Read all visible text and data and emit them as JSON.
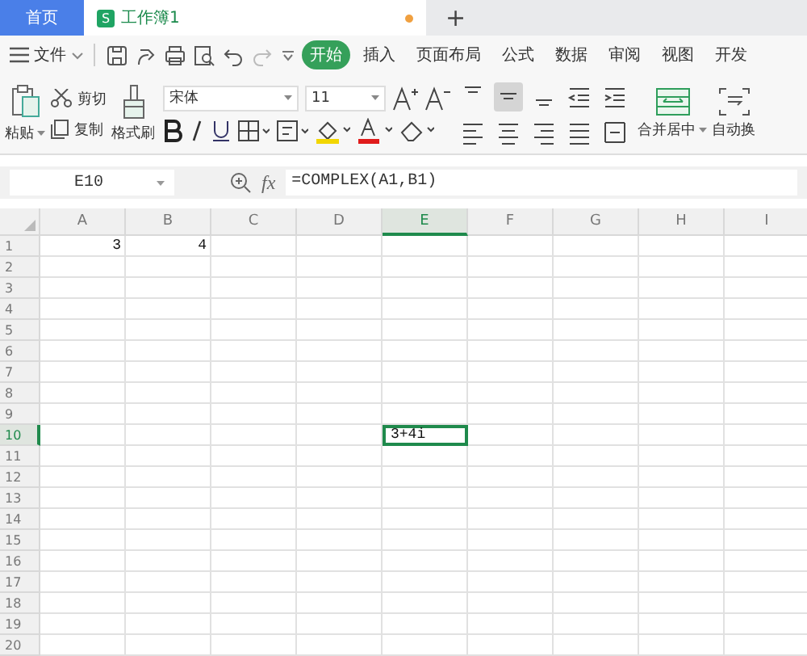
{
  "tabs": [
    {
      "kind": "home",
      "label": "首页",
      "selected": false
    },
    {
      "kind": "doc",
      "label": "工作簿1",
      "icon_letter": "S",
      "unsaved": true,
      "selected": true
    }
  ],
  "new_tab": "+",
  "menu": {
    "file": "文件",
    "items": [
      {
        "label": "开始",
        "selected": true
      },
      {
        "label": "插入",
        "selected": false
      },
      {
        "label": "页面布局",
        "selected": false
      },
      {
        "label": "公式",
        "selected": false
      },
      {
        "label": "数据",
        "selected": false
      },
      {
        "label": "审阅",
        "selected": false
      },
      {
        "label": "视图",
        "selected": false
      },
      {
        "label": "开发",
        "selected": false
      }
    ]
  },
  "clipboard": {
    "paste": "粘贴",
    "cut": "剪切",
    "copy": "复制",
    "format_painter": "格式刷"
  },
  "font": {
    "name": "宋体",
    "size": "11"
  },
  "merge": "合并居中",
  "wrap": "自动换",
  "name_box": "E10",
  "fx": "fx",
  "formula": "=COMPLEX(A1,B1)",
  "columns": [
    {
      "label": "A",
      "selected": false
    },
    {
      "label": "B",
      "selected": false
    },
    {
      "label": "C",
      "selected": false
    },
    {
      "label": "D",
      "selected": false
    },
    {
      "label": "E",
      "selected": true
    },
    {
      "label": "F",
      "selected": false
    },
    {
      "label": "G",
      "selected": false
    },
    {
      "label": "H",
      "selected": false
    },
    {
      "label": "I",
      "selected": false
    }
  ],
  "rows": [
    {
      "label": "1",
      "selected": false,
      "cells": [
        {
          "kind": "number",
          "text": "3"
        },
        {
          "kind": "number",
          "text": "4"
        }
      ]
    },
    {
      "label": "2",
      "selected": false
    },
    {
      "label": "3",
      "selected": false
    },
    {
      "label": "4",
      "selected": false
    },
    {
      "label": "5",
      "selected": false
    },
    {
      "label": "6",
      "selected": false
    },
    {
      "label": "7",
      "selected": false
    },
    {
      "label": "8",
      "selected": false
    },
    {
      "label": "9",
      "selected": false
    },
    {
      "label": "10",
      "selected": true,
      "cells": [
        null,
        null,
        null,
        null,
        {
          "kind": "text",
          "text": "3+4i",
          "selected": true
        }
      ]
    },
    {
      "label": "11",
      "selected": false
    },
    {
      "label": "12",
      "selected": false
    },
    {
      "label": "13",
      "selected": false
    },
    {
      "label": "14",
      "selected": false
    },
    {
      "label": "15",
      "selected": false
    },
    {
      "label": "16",
      "selected": false
    },
    {
      "label": "17",
      "selected": false
    },
    {
      "label": "18",
      "selected": false
    },
    {
      "label": "19",
      "selected": false
    },
    {
      "label": "20",
      "selected": false
    }
  ]
}
